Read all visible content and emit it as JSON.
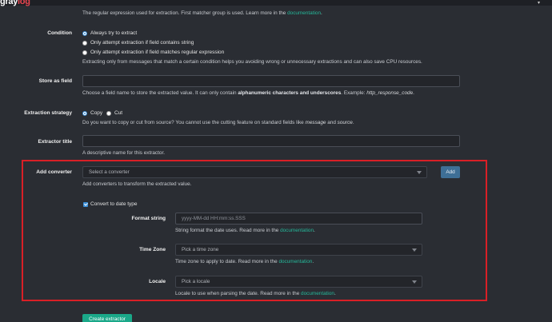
{
  "topbar": {
    "logo_main": "gray",
    "logo_accent": "log",
    "links": [
      "",
      ""
    ]
  },
  "regex_help": {
    "text": "The regular expression used for extraction. First matcher group is used. Learn more in the ",
    "link": "documentation",
    "end": "."
  },
  "condition": {
    "label": "Condition",
    "options": [
      {
        "label": "Always try to extract",
        "checked": true
      },
      {
        "label": "Only attempt extraction if field contains string",
        "checked": false
      },
      {
        "label": "Only attempt extraction if field matches regular expression",
        "checked": false
      }
    ],
    "help": "Extracting only from messages that match a certain condition helps you avoiding wrong or unnecessary extractions and can also save CPU resources."
  },
  "store_as_field": {
    "label": "Store as field",
    "value": "",
    "help_pre": "Choose a field name to store the extracted value. It can only contain ",
    "help_bold": "alphanumeric characters and underscores",
    "help_mid": ". Example: ",
    "help_italic": "http_response_code",
    "help_end": "."
  },
  "extraction_strategy": {
    "label": "Extraction strategy",
    "options": [
      {
        "label": "Copy",
        "checked": true
      },
      {
        "label": "Cut",
        "checked": false
      }
    ],
    "help_pre": "Do you want to copy or cut from source? You cannot use the cutting feature on standard fields like ",
    "help_i1": "message",
    "help_mid": " and ",
    "help_i2": "source",
    "help_end": "."
  },
  "extractor_title": {
    "label": "Extractor title",
    "value": "",
    "help": "A descriptive name for this extractor."
  },
  "add_converter": {
    "label": "Add converter",
    "select_placeholder": "Select a converter",
    "add_button": "Add",
    "help": "Add converters to transform the extracted value."
  },
  "date_converter": {
    "checkbox_label": "Convert to date type",
    "format_label": "Format string",
    "format_placeholder": "yyyy-MM-dd HH:mm:ss.SSS",
    "format_help_pre": "String format the date uses. Read more in the ",
    "format_help_link": "documentation",
    "format_help_end": ".",
    "tz_label": "Time Zone",
    "tz_placeholder": "Pick a time zone",
    "tz_help_pre": "Time zone to apply to date. Read more in the ",
    "tz_help_link": "documentation",
    "tz_help_end": ".",
    "locale_label": "Locale",
    "locale_placeholder": "Pick a locale",
    "locale_help_pre": "Locale to use when parsing the date. Read more in the ",
    "locale_help_link": "documentation",
    "locale_help_end": "."
  },
  "create_button": "Create extractor",
  "colors": {
    "background": "#2a2d33",
    "link": "#25b89a",
    "primary": "#1aa889",
    "highlight": "#d91f26"
  }
}
